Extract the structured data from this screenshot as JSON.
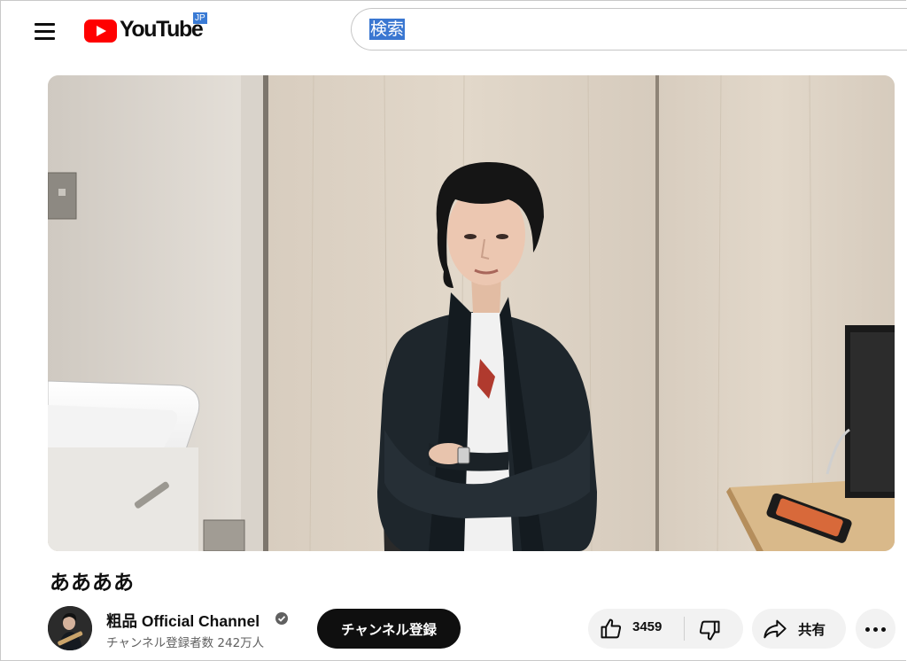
{
  "header": {
    "logo_text": "YouTube",
    "region": "JP",
    "search_value": "検索"
  },
  "video": {
    "title": "ああああ"
  },
  "channel": {
    "name": "粗品 Official Channel",
    "subscribers": "チャンネル登録者数 242万人",
    "subscribe_label": "チャンネル登録"
  },
  "actions": {
    "like_count": "3459",
    "share_label": "共有"
  },
  "colors": {
    "brand_red": "#ff0000",
    "button_dark": "#0f0f0f",
    "pill_bg": "#f2f2f2",
    "selection_blue": "#3a77d1"
  }
}
